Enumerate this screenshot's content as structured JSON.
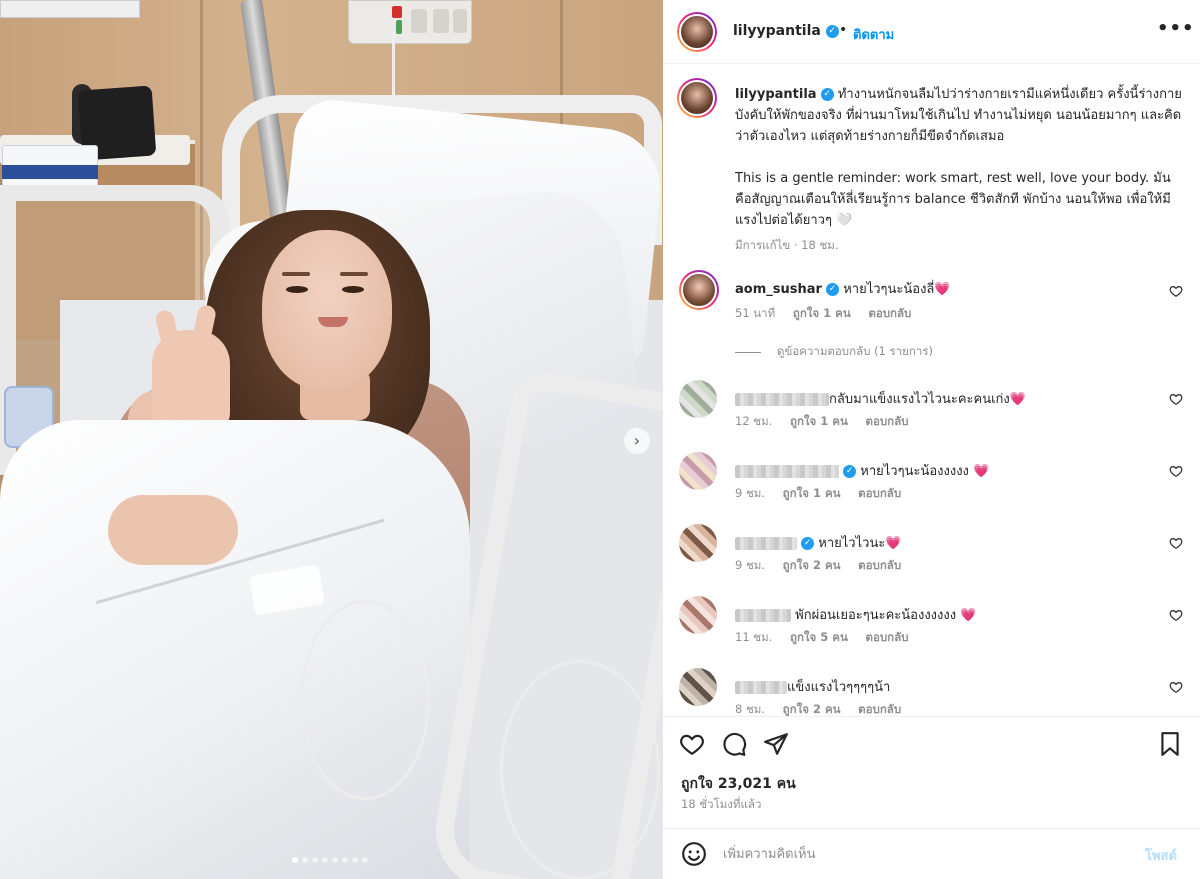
{
  "post": {
    "username": "lilyypantila",
    "follow_label": "ติดตาม",
    "more_label": "•••",
    "separator": "•"
  },
  "caption": {
    "username": "lilyypantila",
    "paragraph1": "ทำงานหนักจนลืมไปว่าร่างกายเรามีแค่หนึ่งเดียว ครั้งนี้ร่างกายบังคับให้พักของจริง ที่ผ่านมาโหมใช้เกินไป ทำงานไม่หยุด นอนน้อยมากๆ และคิดว่าตัวเองไหว แต่สุดท้ายร่างกายก็มีขีดจำกัดเสมอ",
    "paragraph2": "This is a gentle reminder: work smart, rest well, love your body. มันคือสัญญาณเตือนให้ลี่เรียนรู้การ balance ชีวิตสักที พักบ้าง นอนให้พอ เพื่อให้มีแรงไปต่อได้ยาวๆ 🤍",
    "meta": "มีการแก้ไข · 18 ชม."
  },
  "comments": [
    {
      "username": "aom_sushar",
      "verified": true,
      "text": "หายไวๆนะน้องลี่",
      "emoji": "💗",
      "time": "51 นาที",
      "likes": "ถูกใจ 1 คน",
      "reply": "ตอบกลับ"
    },
    {
      "username": "",
      "verified": false,
      "text": "กลับมาแข็งแรงไวไวนะคะคนเก่ง",
      "emoji": "💗",
      "time": "12 ชม.",
      "likes": "ถูกใจ 1 คน",
      "reply": "ตอบกลับ"
    },
    {
      "username": "",
      "verified": true,
      "text": "หายไวๆนะน้องงงงง",
      "emoji": "💗",
      "time": "9 ชม.",
      "likes": "ถูกใจ 1 คน",
      "reply": "ตอบกลับ"
    },
    {
      "username": "",
      "verified": true,
      "text": "หายไวไวนะ",
      "emoji": "💗",
      "time": "9 ชม.",
      "likes": "ถูกใจ 2 คน",
      "reply": "ตอบกลับ"
    },
    {
      "username": "",
      "verified": false,
      "text": "พักผ่อนเยอะๆนะคะน้องงงงงง",
      "emoji": "💗",
      "time": "11 ชม.",
      "likes": "ถูกใจ 5 คน",
      "reply": "ตอบกลับ"
    },
    {
      "username": "",
      "verified": false,
      "text": "แข็งแรงไวๆๆๆๆน้า",
      "emoji": "",
      "time": "8 ชม.",
      "likes": "ถูกใจ 2 คน",
      "reply": "ตอบกลับ"
    }
  ],
  "view_replies": "ดูข้อความตอบกลับ (1 รายการ)",
  "actions": {
    "likes": "ถูกใจ 23,021 คน",
    "time": "18 ชั่วโมงที่แล้ว"
  },
  "add_comment": {
    "placeholder": "เพิ่มความคิดเห็น",
    "post_label": "โพสต์"
  },
  "colors": {
    "accent": "#0095f6",
    "verified": "#1f9bf0",
    "heart": "#ed2d6c"
  },
  "carousel": {
    "next_icon": "›"
  }
}
